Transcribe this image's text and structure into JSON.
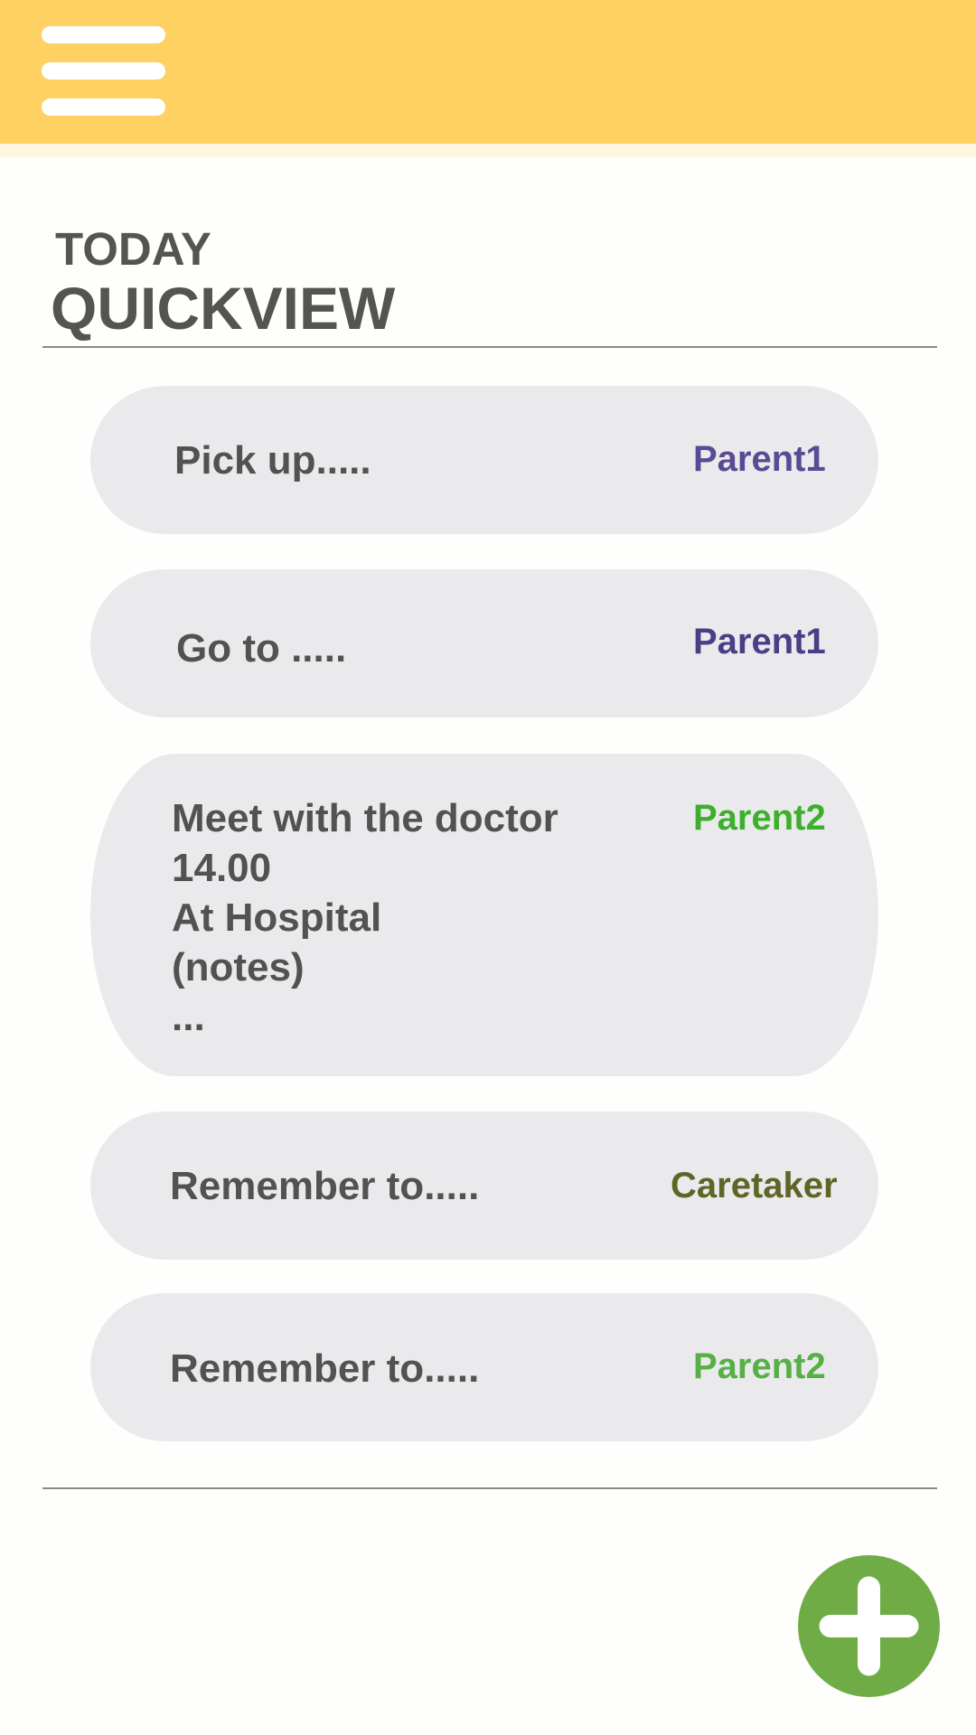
{
  "heading": {
    "line1": "TODAY",
    "line2": "QUICKVIEW"
  },
  "icons": {
    "menu": "hamburger-menu-icon",
    "add": "plus-icon"
  },
  "tasks": [
    {
      "text": "Pick up.....",
      "assignee": "Parent1",
      "assignee_color": "#5a4a94"
    },
    {
      "text": "Go to .....",
      "assignee": "Parent1",
      "assignee_color": "#4a3e86"
    },
    {
      "text": "Meet with the doctor\n14.00\nAt Hospital\n(notes)\n...",
      "assignee": "Parent2",
      "assignee_color": "#3daf2c"
    },
    {
      "text": "Remember to.....",
      "assignee": "Caretaker",
      "assignee_color": "#5f6427"
    },
    {
      "text": "Remember to.....",
      "assignee": "Parent2",
      "assignee_color": "#57b046"
    }
  ],
  "colors": {
    "app_bar": "#fed162",
    "card": "#eaeaec",
    "fab": "#6fac46",
    "heading": "#555550"
  }
}
